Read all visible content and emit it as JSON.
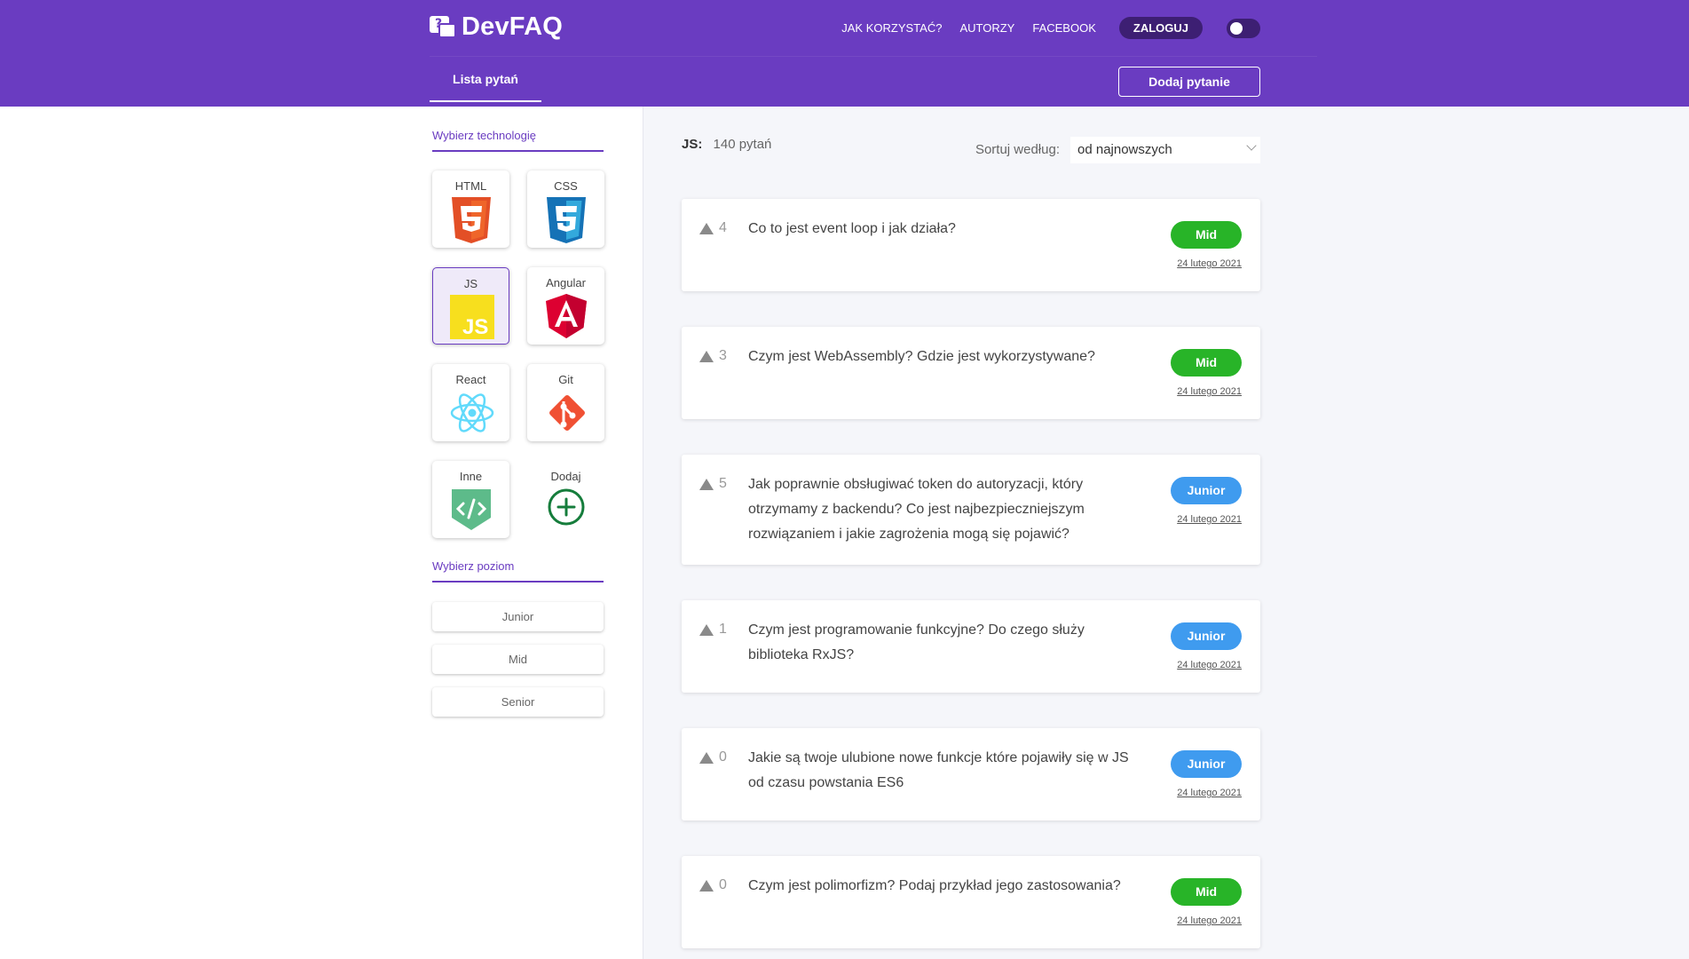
{
  "header": {
    "logo_text": "DevFAQ",
    "logo_mark": "?",
    "nav": [
      "JAK KORZYSTAĆ?",
      "AUTORZY",
      "FACEBOOK"
    ],
    "login_label": "ZALOGUJ",
    "active_tab": "Lista pytań",
    "add_question_label": "Dodaj pytanie"
  },
  "sidebar": {
    "tech_title": "Wybierz technologię",
    "technologies": [
      {
        "label": "HTML",
        "icon": "html5-icon"
      },
      {
        "label": "CSS",
        "icon": "css3-icon"
      },
      {
        "label": "JS",
        "icon": "js-icon",
        "active": true
      },
      {
        "label": "Angular",
        "icon": "angular-icon"
      },
      {
        "label": "React",
        "icon": "react-icon"
      },
      {
        "label": "Git",
        "icon": "git-icon"
      },
      {
        "label": "Inne",
        "icon": "code-icon"
      },
      {
        "label": "Dodaj",
        "icon": "plus-circle-icon"
      }
    ],
    "level_title": "Wybierz poziom",
    "levels": [
      "Junior",
      "Mid",
      "Senior"
    ]
  },
  "list": {
    "tech_key": "JS:",
    "count": "140 pytań",
    "sort_label": "Sortuj według:",
    "sort_value": "od najnowszych"
  },
  "questions": [
    {
      "votes": "4",
      "text": "Co to jest event loop i jak działa?",
      "level": "Mid",
      "date": "24 lutego 2021"
    },
    {
      "votes": "3",
      "text": "Czym jest WebAssembly? Gdzie jest wykorzystywane?",
      "level": "Mid",
      "date": "24 lutego 2021"
    },
    {
      "votes": "5",
      "text": "Jak poprawnie obsługiwać token do autoryzacji, który otrzymamy z backendu? Co jest najbezpieczniejszym rozwiązaniem i jakie zagrożenia mogą się pojawić?",
      "level": "Junior",
      "date": "24 lutego 2021"
    },
    {
      "votes": "1",
      "text": "Czym jest programowanie funkcyjne? Do czego służy biblioteka RxJS?",
      "level": "Junior",
      "date": "24 lutego 2021"
    },
    {
      "votes": "0",
      "text": "Jakie są twoje ulubione nowe funkcje które pojawiły się w JS od czasu powstania ES6",
      "level": "Junior",
      "date": "24 lutego 2021"
    },
    {
      "votes": "0",
      "text": "Czym jest polimorfizm? Podaj przykład jego zastosowania?",
      "level": "Mid",
      "date": "24 lutego 2021"
    }
  ],
  "colors": {
    "brand": "#6a3cc1",
    "mid": "#28b428",
    "junior": "#3f9bef"
  }
}
